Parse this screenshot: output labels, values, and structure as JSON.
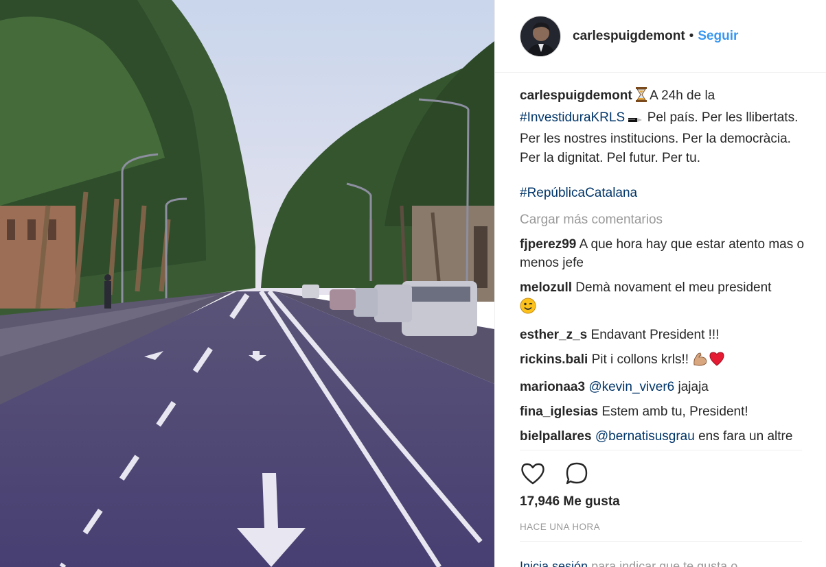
{
  "header": {
    "username": "carlespuigdemont",
    "separator": "•",
    "follow_label": "Seguir"
  },
  "caption": {
    "username": "carlespuigdemont",
    "text_before_tag": " A 24h de la ",
    "hashtag1": "#InvestiduraKRLS",
    "text_after_tag": " Pel país. Per les llibertats. Per les nostres institucions. Per la democràcia. Per la dignitat. Pel futur. Per tu.",
    "hashtag2": "#RepúblicaCatalana",
    "emoji_hourglass": "hourglass-icon",
    "emoji_pen": "pen-icon"
  },
  "load_more": "Cargar más comentarios",
  "comments": [
    {
      "user": "fjperez99",
      "text": "A que hora hay que estar atento mas o menos jefe"
    },
    {
      "user": "melozull",
      "text": "Demà novament el meu president"
    },
    {
      "user": "esther_z_s",
      "text": "Endavant President !!!"
    },
    {
      "user": "rickins.bali",
      "text": "Pit i collons krls!!"
    },
    {
      "user": "marionaa3",
      "mention": "@kevin_viver6",
      "text": " jajaja"
    },
    {
      "user": "fina_iglesias",
      "text": "Estem amb tu, President!"
    },
    {
      "user": "bielpallares",
      "mention": "@bernatisusgrau",
      "text": " ens fara un altre pua?"
    }
  ],
  "likes": "17,946 Me gusta",
  "time": "HACE UNA HORA",
  "login": {
    "link": "Inicia sesión",
    "text": " para indicar que te gusta o"
  },
  "icons": {
    "like": "heart-outline-icon",
    "comment": "comment-bubble-icon"
  },
  "colors": {
    "link_blue": "#3897f0",
    "tag_blue": "#003569",
    "muted": "#999999"
  }
}
